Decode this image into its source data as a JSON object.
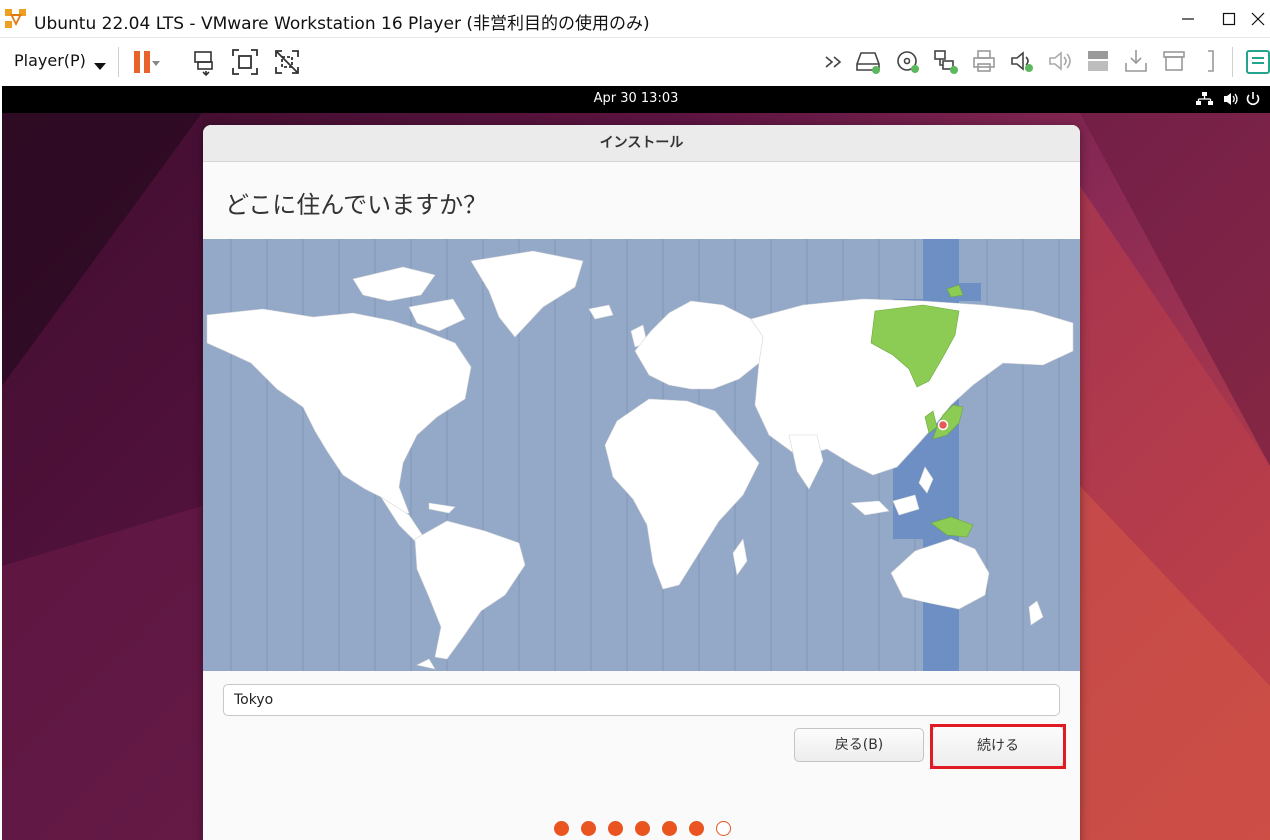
{
  "window": {
    "title": "Ubuntu 22.04 LTS - VMware Workstation 16 Player (非営利目的の使用のみ)"
  },
  "toolbar": {
    "player_menu_label": "Player(P)",
    "icons": [
      "pause-icon",
      "send-ctrl-alt-del-icon",
      "full-screen-icon",
      "unity-icon",
      "more-devices-icon",
      "hard-disk-icon",
      "cd-dvd-icon",
      "network-adapter-icon",
      "printer-icon",
      "sound-card-icon",
      "sound-icon",
      "usb-controller-icon",
      "usb-device-icon",
      "removable-device-icon",
      "serial-port-icon",
      "message-log-icon"
    ]
  },
  "guest": {
    "clock": "Apr 30  13:03",
    "status_icons": [
      "network-icon",
      "volume-icon",
      "power-icon"
    ]
  },
  "installer": {
    "window_title": "インストール",
    "question": "どこに住んでいますか？",
    "timezone_value": "Tokyo",
    "back_button": "戻る(B)",
    "continue_button": "続ける",
    "progress": {
      "total_steps": 7,
      "completed_steps": 6
    },
    "map": {
      "highlight_color": "#8ccc55",
      "ocean_color": "#94a8c8",
      "selected_band_color": "#6d8fc4",
      "marker_color": "#e85a5a"
    }
  },
  "colors": {
    "accent": "#e95420",
    "highlight_border": "#e01b24"
  }
}
